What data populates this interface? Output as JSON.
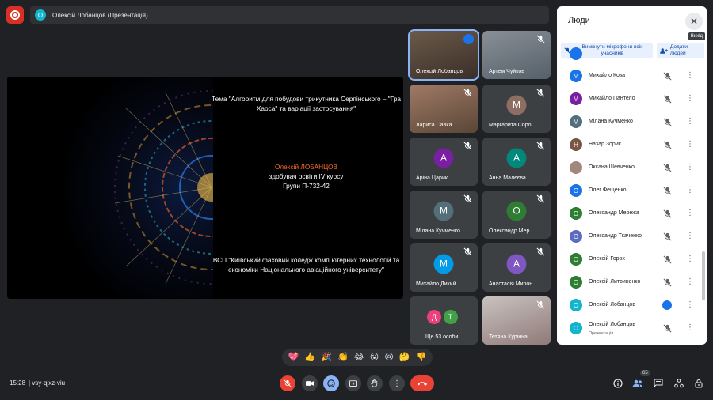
{
  "presenter_bar": {
    "avatar_letter": "О",
    "text": "Олексій Лобанцов (Презентація)"
  },
  "slide": {
    "topic": "Тема \"Алгоритм для побудови трикутника Серпінського – \"Гра Хаоса\" та варіації застосування\"",
    "author_name": "Олексій ЛОБАНЦОВ",
    "author_role": "здобувач освіти IV курсу",
    "author_group": "Групи П-732-42",
    "college": "ВСП \"Київський фаховий коледж комп`ютерних технологій та економіки Національного авіаційного університету\""
  },
  "tiles": [
    {
      "name": "Олексій Лобанцов",
      "kind": "camera",
      "state": "speaking"
    },
    {
      "name": "Артем Чуйков",
      "kind": "camera",
      "state": "muted"
    },
    {
      "name": "Лариса Савка",
      "kind": "camera",
      "state": "muted"
    },
    {
      "name": "Маргарита Соро...",
      "letter": "М",
      "color": "#8d6e63",
      "state": "muted"
    },
    {
      "name": "Аріна Царик",
      "letter": "А",
      "color": "#7b1fa2",
      "state": "muted"
    },
    {
      "name": "Анна Малєєва",
      "letter": "А",
      "color": "#00897b",
      "state": "muted"
    },
    {
      "name": "Мілана Кучменко",
      "letter": "М",
      "color": "#546e7a",
      "state": "muted"
    },
    {
      "name": "Олександр Мер...",
      "letter": "О",
      "color": "#2e7d32",
      "state": "muted"
    },
    {
      "name": "Михайло Дикий",
      "letter": "М",
      "color": "#039be5",
      "state": "muted"
    },
    {
      "name": "Анастасія Мирон...",
      "letter": "А",
      "color": "#7e57c2",
      "state": "muted"
    },
    {
      "name": "Ще 53 особи",
      "letters": [
        "Д",
        "Т"
      ],
      "colors": [
        "#ec407a",
        "#43a047"
      ]
    },
    {
      "name": "Тетяна Курінна",
      "kind": "camera",
      "state": "muted"
    }
  ],
  "panel": {
    "title": "Люди",
    "close_tooltip": "Вихід",
    "mute_all_label": "Вимкнути мікрофони всіх учасників",
    "add_people_label": "Додати людей",
    "participants": [
      {
        "name": "Михайло Коза",
        "letter": "М",
        "color": "#1a73e8",
        "state": "muted"
      },
      {
        "name": "Михайло Пантело",
        "letter": "М",
        "color": "#7b1fa2",
        "state": "muted"
      },
      {
        "name": "Мілана Кучменко",
        "letter": "М",
        "color": "#546e7a",
        "state": "muted"
      },
      {
        "name": "Назар Зорик",
        "letter": "Н",
        "color": "#795548",
        "state": "muted"
      },
      {
        "name": "Оксана Шевченко",
        "letter": "",
        "color": "#a1887f",
        "state": "muted"
      },
      {
        "name": "Олег Фещенко",
        "letter": "О",
        "color": "#1a73e8",
        "state": "muted"
      },
      {
        "name": "Олександр Мережа",
        "letter": "О",
        "color": "#2e7d32",
        "state": "muted"
      },
      {
        "name": "Олександр Ткаченко",
        "letter": "О",
        "color": "#5c6bc0",
        "state": "muted"
      },
      {
        "name": "Олексій Горох",
        "letter": "О",
        "color": "#2e7d32",
        "state": "muted"
      },
      {
        "name": "Олексій Литвиненко",
        "letter": "О",
        "color": "#2e7d32",
        "state": "muted"
      },
      {
        "name": "Олексій Лобанцов",
        "letter": "О",
        "color": "#12b5cb",
        "state": "speaking"
      },
      {
        "name": "Олексій Лобанцов",
        "sub": "Презентація",
        "letter": "О",
        "color": "#12b5cb",
        "state": "muted"
      }
    ]
  },
  "reactions": [
    "💖",
    "👍",
    "🎉",
    "👏",
    "😂",
    "😮",
    "😢",
    "🤔",
    "👎"
  ],
  "bottom": {
    "time": "15:28",
    "separator": "|",
    "meeting_code": "vsy-qjxz-viu",
    "people_count": "65"
  },
  "colors": {
    "background": "#202124",
    "accent": "#8ab4f8",
    "danger": "#ea4335"
  }
}
